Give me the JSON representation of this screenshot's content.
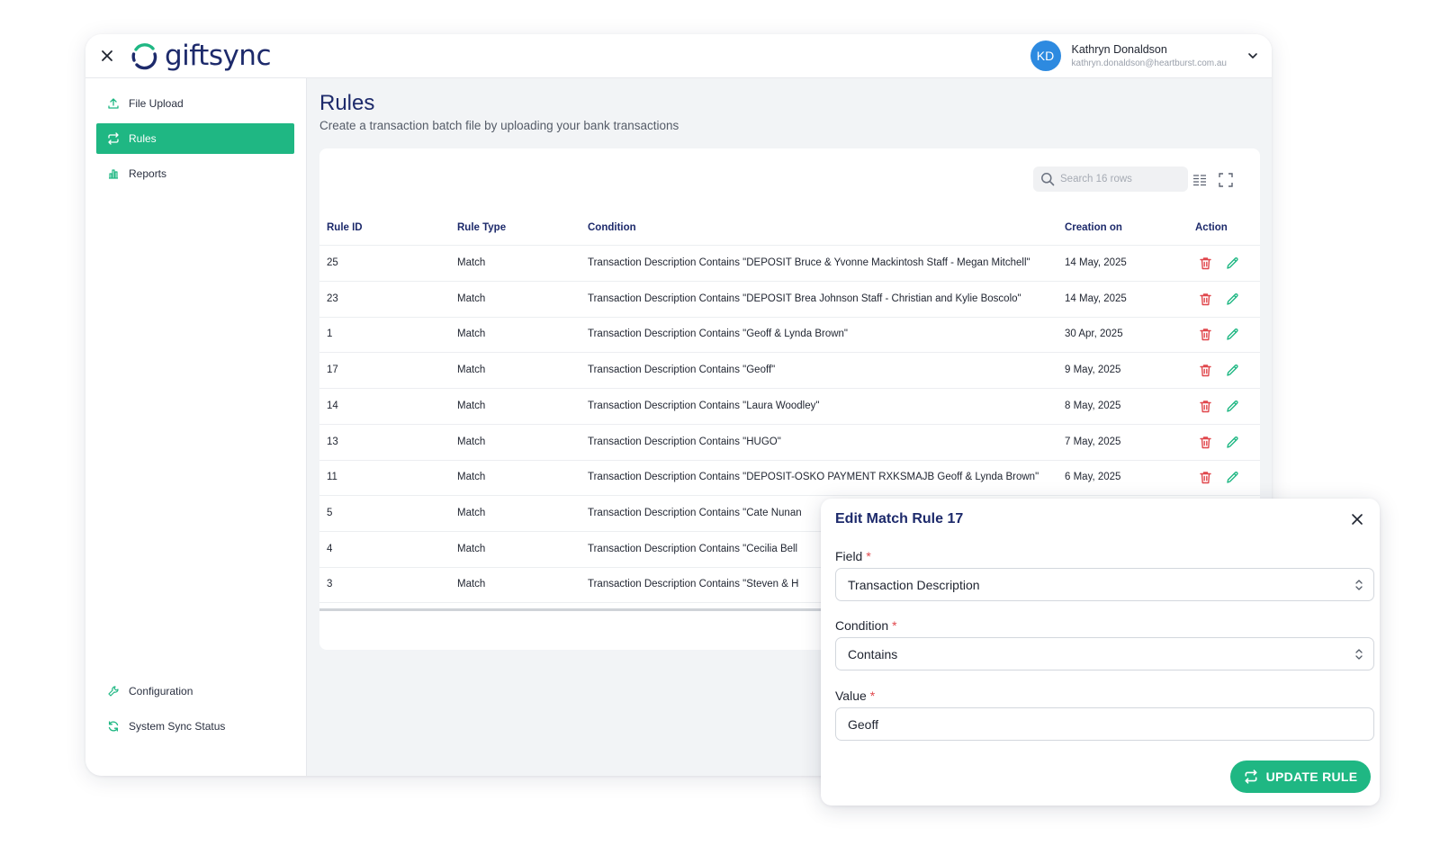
{
  "app": {
    "brand": "giftsync"
  },
  "user": {
    "initials": "KD",
    "name": "Kathryn Donaldson",
    "email": "kathryn.donaldson@heartburst.com.au"
  },
  "sidebar": {
    "items": [
      {
        "label": "File Upload",
        "icon": "upload-icon"
      },
      {
        "label": "Rules",
        "icon": "sync-arrows-icon",
        "active": true
      },
      {
        "label": "Reports",
        "icon": "bar-chart-icon"
      }
    ],
    "bottom_items": [
      {
        "label": "Configuration",
        "icon": "wrench-icon"
      },
      {
        "label": "System Sync Status",
        "icon": "refresh-icon"
      }
    ]
  },
  "page": {
    "title": "Rules",
    "subtitle": "Create a transaction batch file by uploading your bank transactions"
  },
  "table": {
    "search_placeholder": "Search 16 rows",
    "columns": [
      "Rule ID",
      "Rule Type",
      "Condition",
      "Creation on",
      "Action"
    ],
    "rows": [
      {
        "id": "25",
        "type": "Match",
        "condition": "Transaction Description Contains \"DEPOSIT Bruce & Yvonne Mackintosh Staff - Megan Mitchell\"",
        "created": "14 May, 2025"
      },
      {
        "id": "23",
        "type": "Match",
        "condition": "Transaction Description Contains \"DEPOSIT Brea Johnson Staff - Christian and Kylie Boscolo\"",
        "created": "14 May, 2025"
      },
      {
        "id": "1",
        "type": "Match",
        "condition": "Transaction Description Contains \"Geoff & Lynda Brown\"",
        "created": "30 Apr, 2025"
      },
      {
        "id": "17",
        "type": "Match",
        "condition": "Transaction Description Contains \"Geoff\"",
        "created": "9 May, 2025"
      },
      {
        "id": "14",
        "type": "Match",
        "condition": "Transaction Description Contains \"Laura Woodley\"",
        "created": "8 May, 2025"
      },
      {
        "id": "13",
        "type": "Match",
        "condition": "Transaction Description Contains \"HUGO\"",
        "created": "7 May, 2025"
      },
      {
        "id": "11",
        "type": "Match",
        "condition": "Transaction Description Contains \"DEPOSIT-OSKO PAYMENT RXKSMAJB Geoff & Lynda Brown\"",
        "created": "6 May, 2025"
      },
      {
        "id": "5",
        "type": "Match",
        "condition": "Transaction Description Contains \"Cate Nunan",
        "created": ""
      },
      {
        "id": "4",
        "type": "Match",
        "condition": "Transaction Description Contains \"Cecilia Bell",
        "created": ""
      },
      {
        "id": "3",
        "type": "Match",
        "condition": "Transaction Description Contains \"Steven & H",
        "created": ""
      }
    ]
  },
  "modal": {
    "title": "Edit Match Rule 17",
    "field_label": "Field",
    "field_value": "Transaction Description",
    "condition_label": "Condition",
    "condition_value": "Contains",
    "value_label": "Value",
    "value_value": "Geoff",
    "required_mark": "*",
    "submit_label": "UPDATE RULE"
  },
  "colors": {
    "brand_navy": "#1d2a6b",
    "accent_green": "#1fb783",
    "danger_red": "#e0474c",
    "avatar_blue": "#2d8ae0"
  }
}
